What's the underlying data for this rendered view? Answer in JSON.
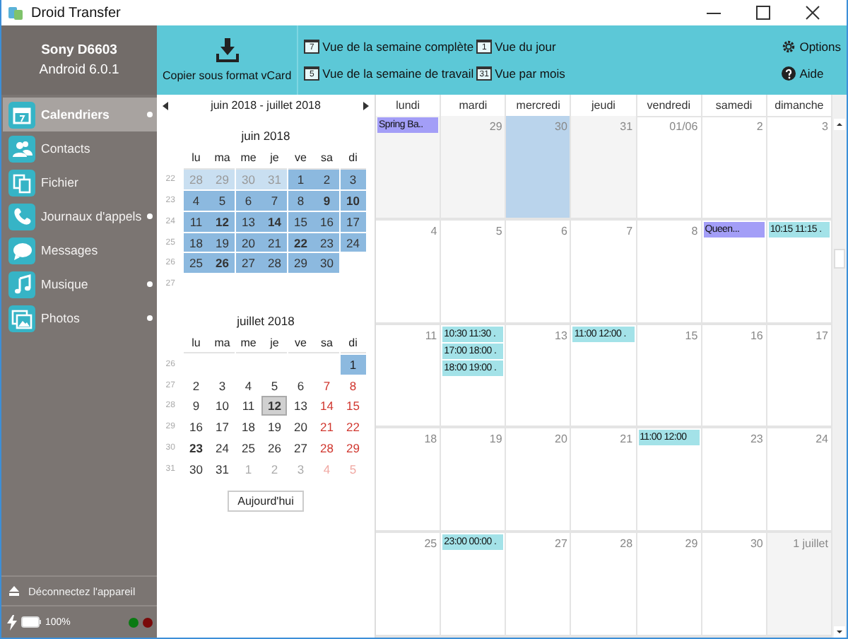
{
  "window": {
    "title": "Droid Transfer"
  },
  "device": {
    "name": "Sony D6603",
    "os": "Android 6.0.1"
  },
  "sidebar": {
    "items": [
      {
        "kind": "calendar",
        "label": "Calendriers",
        "selected": true,
        "dot": true
      },
      {
        "kind": "contacts",
        "label": "Contacts",
        "selected": false,
        "dot": false
      },
      {
        "kind": "files",
        "label": "Fichier",
        "selected": false,
        "dot": false
      },
      {
        "kind": "calls",
        "label": "Journaux d'appels",
        "selected": false,
        "dot": true
      },
      {
        "kind": "messages",
        "label": "Messages",
        "selected": false,
        "dot": false
      },
      {
        "kind": "music",
        "label": "Musique",
        "selected": false,
        "dot": true
      },
      {
        "kind": "photos",
        "label": "Photos",
        "selected": false,
        "dot": true
      }
    ],
    "disconnect": "Déconnectez l'appareil",
    "battery": "100%",
    "status_dots": [
      {
        "color": "#0a7a12"
      },
      {
        "color": "#7a0a0a"
      }
    ]
  },
  "toolbar": {
    "export": "Copier sous format vCard",
    "views": [
      {
        "icon_text": "7",
        "label": "Vue de la semaine complète"
      },
      {
        "icon_text": "5",
        "label": "Vue de la semaine de travail"
      },
      {
        "icon_text": "1",
        "label": "Vue du jour"
      },
      {
        "icon_text": "31",
        "label": "Vue par mois"
      }
    ],
    "options": "Options",
    "help": "Aide"
  },
  "mini_calendar": {
    "range": "juin 2018 - juillet 2018",
    "today_button": "Aujourd'hui",
    "months": [
      {
        "title": "juin 2018",
        "weekdays": [
          "lu",
          "ma",
          "me",
          "je",
          "ve",
          "sa",
          "di"
        ],
        "weeks": [
          {
            "num": "22",
            "days": [
              {
                "d": "28",
                "kind": "other",
                "selected": true,
                "bold": false,
                "today": false
              },
              {
                "d": "29",
                "kind": "other",
                "selected": true,
                "bold": false,
                "today": false
              },
              {
                "d": "30",
                "kind": "other",
                "selected": true,
                "bold": false,
                "today": false
              },
              {
                "d": "31",
                "kind": "other",
                "selected": true,
                "bold": false,
                "today": false
              },
              {
                "d": "1",
                "kind": "day",
                "selected": true,
                "bold": false,
                "today": false
              },
              {
                "d": "2",
                "kind": "day",
                "selected": true,
                "bold": false,
                "today": false
              },
              {
                "d": "3",
                "kind": "day",
                "selected": true,
                "bold": false,
                "today": false
              }
            ]
          },
          {
            "num": "23",
            "days": [
              {
                "d": "4",
                "kind": "day",
                "selected": true,
                "bold": false,
                "today": false
              },
              {
                "d": "5",
                "kind": "day",
                "selected": true,
                "bold": false,
                "today": false
              },
              {
                "d": "6",
                "kind": "day",
                "selected": true,
                "bold": false,
                "today": false
              },
              {
                "d": "7",
                "kind": "day",
                "selected": true,
                "bold": false,
                "today": false
              },
              {
                "d": "8",
                "kind": "day",
                "selected": true,
                "bold": false,
                "today": false
              },
              {
                "d": "9",
                "kind": "day",
                "selected": true,
                "bold": true,
                "today": false
              },
              {
                "d": "10",
                "kind": "day",
                "selected": true,
                "bold": true,
                "today": false
              }
            ]
          },
          {
            "num": "24",
            "days": [
              {
                "d": "11",
                "kind": "day",
                "selected": true,
                "bold": false,
                "today": false
              },
              {
                "d": "12",
                "kind": "day",
                "selected": true,
                "bold": true,
                "today": false
              },
              {
                "d": "13",
                "kind": "day",
                "selected": true,
                "bold": false,
                "today": false
              },
              {
                "d": "14",
                "kind": "day",
                "selected": true,
                "bold": true,
                "today": false
              },
              {
                "d": "15",
                "kind": "day",
                "selected": true,
                "bold": false,
                "today": false
              },
              {
                "d": "16",
                "kind": "day",
                "selected": true,
                "bold": false,
                "today": false
              },
              {
                "d": "17",
                "kind": "day",
                "selected": true,
                "bold": false,
                "today": false
              }
            ]
          },
          {
            "num": "25",
            "days": [
              {
                "d": "18",
                "kind": "day",
                "selected": true,
                "bold": false,
                "today": false
              },
              {
                "d": "19",
                "kind": "day",
                "selected": true,
                "bold": false,
                "today": false
              },
              {
                "d": "20",
                "kind": "day",
                "selected": true,
                "bold": false,
                "today": false
              },
              {
                "d": "21",
                "kind": "day",
                "selected": true,
                "bold": false,
                "today": false
              },
              {
                "d": "22",
                "kind": "day",
                "selected": true,
                "bold": true,
                "today": false
              },
              {
                "d": "23",
                "kind": "day",
                "selected": true,
                "bold": false,
                "today": false
              },
              {
                "d": "24",
                "kind": "day",
                "selected": true,
                "bold": false,
                "today": false
              }
            ]
          },
          {
            "num": "26",
            "days": [
              {
                "d": "25",
                "kind": "day",
                "selected": true,
                "bold": false,
                "today": false
              },
              {
                "d": "26",
                "kind": "day",
                "selected": true,
                "bold": true,
                "today": false
              },
              {
                "d": "27",
                "kind": "day",
                "selected": true,
                "bold": false,
                "today": false
              },
              {
                "d": "28",
                "kind": "day",
                "selected": true,
                "bold": false,
                "today": false
              },
              {
                "d": "29",
                "kind": "day",
                "selected": true,
                "bold": false,
                "today": false
              },
              {
                "d": "30",
                "kind": "day",
                "selected": true,
                "bold": false,
                "today": false
              }
            ]
          },
          {
            "num": "27"
          }
        ]
      },
      {
        "title": "juillet 2018",
        "weekdays": [
          "lu",
          "ma",
          "me",
          "je",
          "ve",
          "sa",
          "di"
        ],
        "weeks": [
          {
            "num": "26",
            "days": [
              {
                "d": "1",
                "kind": "weekend",
                "selected": true,
                "bold": false,
                "today": false
              }
            ]
          },
          {
            "num": "27",
            "days": [
              {
                "d": "2",
                "kind": "day",
                "selected": false,
                "bold": false,
                "today": false
              },
              {
                "d": "3",
                "kind": "day",
                "selected": false,
                "bold": false,
                "today": false
              },
              {
                "d": "4",
                "kind": "day",
                "selected": false,
                "bold": false,
                "today": false
              },
              {
                "d": "5",
                "kind": "day",
                "selected": false,
                "bold": false,
                "today": false
              },
              {
                "d": "6",
                "kind": "day",
                "selected": false,
                "bold": false,
                "today": false
              },
              {
                "d": "7",
                "kind": "weekend",
                "selected": false,
                "bold": false,
                "today": false
              },
              {
                "d": "8",
                "kind": "weekend",
                "selected": false,
                "bold": false,
                "today": false
              }
            ]
          },
          {
            "num": "28",
            "days": [
              {
                "d": "9",
                "kind": "day",
                "selected": false,
                "bold": false,
                "today": false
              },
              {
                "d": "10",
                "kind": "day",
                "selected": false,
                "bold": false,
                "today": false
              },
              {
                "d": "11",
                "kind": "day",
                "selected": false,
                "bold": false,
                "today": false
              },
              {
                "d": "12",
                "kind": "day",
                "selected": false,
                "bold": true,
                "today": true
              },
              {
                "d": "13",
                "kind": "day",
                "selected": false,
                "bold": false,
                "today": false
              },
              {
                "d": "14",
                "kind": "weekend",
                "selected": false,
                "bold": false,
                "today": false
              },
              {
                "d": "15",
                "kind": "weekend",
                "selected": false,
                "bold": false,
                "today": false
              }
            ]
          },
          {
            "num": "29",
            "days": [
              {
                "d": "16",
                "kind": "day",
                "selected": false,
                "bold": false,
                "today": false
              },
              {
                "d": "17",
                "kind": "day",
                "selected": false,
                "bold": false,
                "today": false
              },
              {
                "d": "18",
                "kind": "day",
                "selected": false,
                "bold": false,
                "today": false
              },
              {
                "d": "19",
                "kind": "day",
                "selected": false,
                "bold": false,
                "today": false
              },
              {
                "d": "20",
                "kind": "day",
                "selected": false,
                "bold": false,
                "today": false
              },
              {
                "d": "21",
                "kind": "weekend",
                "selected": false,
                "bold": false,
                "today": false
              },
              {
                "d": "22",
                "kind": "weekend",
                "selected": false,
                "bold": false,
                "today": false
              }
            ]
          },
          {
            "num": "30",
            "days": [
              {
                "d": "23",
                "kind": "day",
                "selected": false,
                "bold": true,
                "today": false
              },
              {
                "d": "24",
                "kind": "day",
                "selected": false,
                "bold": false,
                "today": false
              },
              {
                "d": "25",
                "kind": "day",
                "selected": false,
                "bold": false,
                "today": false
              },
              {
                "d": "26",
                "kind": "day",
                "selected": false,
                "bold": false,
                "today": false
              },
              {
                "d": "27",
                "kind": "day",
                "selected": false,
                "bold": false,
                "today": false
              },
              {
                "d": "28",
                "kind": "weekend",
                "selected": false,
                "bold": false,
                "today": false
              },
              {
                "d": "29",
                "kind": "weekend",
                "selected": false,
                "bold": false,
                "today": false
              }
            ]
          },
          {
            "num": "31",
            "days": [
              {
                "d": "30",
                "kind": "day",
                "selected": false,
                "bold": false,
                "today": false
              },
              {
                "d": "31",
                "kind": "day",
                "selected": false,
                "bold": false,
                "today": false
              },
              {
                "d": "1",
                "kind": "other",
                "selected": false,
                "bold": false,
                "today": false
              },
              {
                "d": "2",
                "kind": "other",
                "selected": false,
                "bold": false,
                "today": false
              },
              {
                "d": "3",
                "kind": "other",
                "selected": false,
                "bold": false,
                "today": false
              },
              {
                "d": "4",
                "kind": "other-weekend",
                "selected": false,
                "bold": false,
                "today": false
              },
              {
                "d": "5",
                "kind": "other-weekend",
                "selected": false,
                "bold": false,
                "today": false
              }
            ]
          }
        ]
      }
    ]
  },
  "month_view": {
    "columns": [
      "lundi",
      "mardi",
      "mercredi",
      "jeudi",
      "vendredi",
      "samedi",
      "dimanche"
    ],
    "weeks": [
      [
        {
          "kind": "other",
          "selected": false,
          "events": [
            {
              "text": "Spring Ba..",
              "color": "#a39ef7"
            }
          ]
        },
        {
          "date": "29",
          "kind": "other",
          "selected": false
        },
        {
          "date": "30",
          "kind": "other",
          "selected": true
        },
        {
          "date": "31",
          "kind": "other",
          "selected": false
        },
        {
          "date": "01/06",
          "kind": "day",
          "selected": false
        },
        {
          "date": "2",
          "kind": "day",
          "selected": false
        },
        {
          "date": "3",
          "kind": "day",
          "selected": false
        }
      ],
      [
        {
          "date": "4",
          "kind": "day",
          "selected": false
        },
        {
          "date": "5",
          "kind": "day",
          "selected": false
        },
        {
          "date": "6",
          "kind": "day",
          "selected": false
        },
        {
          "date": "7",
          "kind": "day",
          "selected": false
        },
        {
          "date": "8",
          "kind": "day",
          "selected": false
        },
        {
          "kind": "day",
          "selected": false,
          "events": [
            {
              "text": "Queen...",
              "color": "#a39ef7"
            }
          ]
        },
        {
          "kind": "day",
          "selected": false,
          "events": [
            {
              "text": "10:15 11:15 .",
              "color": "#a3e2e8"
            }
          ]
        }
      ],
      [
        {
          "date": "11",
          "kind": "day",
          "selected": false
        },
        {
          "kind": "day",
          "selected": false,
          "events": [
            {
              "text": "10:30 11:30 .",
              "color": "#a3e2e8"
            },
            {
              "text": "17:00 18:00 .",
              "color": "#a3e2e8"
            },
            {
              "text": "18:00 19:00 .",
              "color": "#a3e2e8"
            }
          ]
        },
        {
          "date": "13",
          "kind": "day",
          "selected": false
        },
        {
          "kind": "day",
          "selected": false,
          "events": [
            {
              "text": "11:00 12:00 .",
              "color": "#a3e2e8"
            }
          ]
        },
        {
          "date": "15",
          "kind": "day",
          "selected": false
        },
        {
          "date": "16",
          "kind": "day",
          "selected": false
        },
        {
          "date": "17",
          "kind": "day",
          "selected": false
        }
      ],
      [
        {
          "date": "18",
          "kind": "day",
          "selected": false
        },
        {
          "date": "19",
          "kind": "day",
          "selected": false
        },
        {
          "date": "20",
          "kind": "day",
          "selected": false
        },
        {
          "date": "21",
          "kind": "day",
          "selected": false
        },
        {
          "kind": "day",
          "selected": false,
          "events": [
            {
              "text": "11:00 12:00",
              "color": "#a3e2e8"
            }
          ]
        },
        {
          "date": "23",
          "kind": "day",
          "selected": false
        },
        {
          "date": "24",
          "kind": "day",
          "selected": false
        }
      ],
      [
        {
          "date": "25",
          "kind": "day",
          "selected": false
        },
        {
          "kind": "day",
          "selected": false,
          "events": [
            {
              "text": "23:00 00:00 .",
              "color": "#a3e2e8"
            }
          ]
        },
        {
          "date": "27",
          "kind": "day",
          "selected": false
        },
        {
          "date": "28",
          "kind": "day",
          "selected": false
        },
        {
          "date": "29",
          "kind": "day",
          "selected": false
        },
        {
          "date": "30",
          "kind": "day",
          "selected": false
        },
        {
          "date": "1 juillet",
          "kind": "other",
          "selected": false
        }
      ]
    ]
  }
}
